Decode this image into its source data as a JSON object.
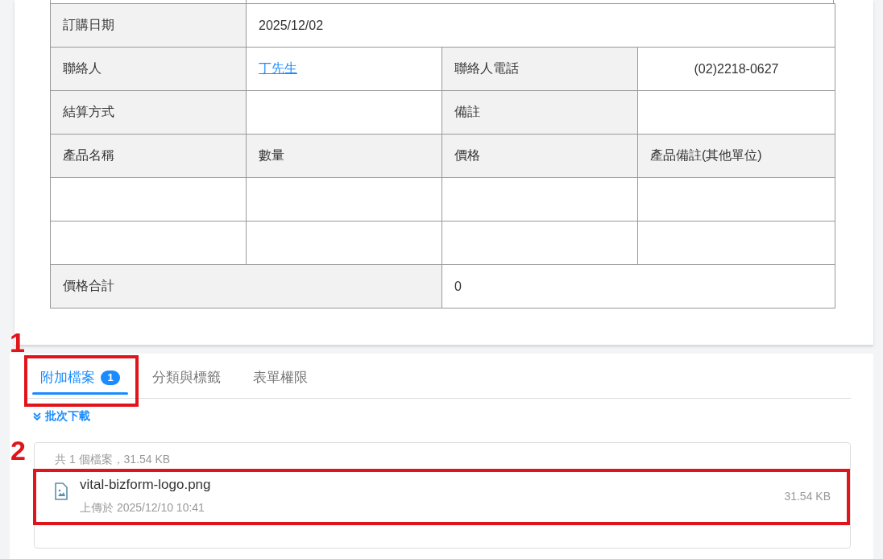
{
  "order_table": {
    "rows": [
      {
        "cells": [
          {
            "kind": "label",
            "text": "訂購日期"
          },
          {
            "kind": "value",
            "text": "2025/12/02",
            "colspan": 3
          }
        ]
      },
      {
        "cells": [
          {
            "kind": "label",
            "text": "聯絡人"
          },
          {
            "kind": "link",
            "text": "丁先生 "
          },
          {
            "kind": "label",
            "text": "聯絡人電話"
          },
          {
            "kind": "centered",
            "text": "(02)2218-0627"
          }
        ]
      },
      {
        "cells": [
          {
            "kind": "label",
            "text": "結算方式"
          },
          {
            "kind": "value"
          },
          {
            "kind": "label",
            "text": "備註"
          },
          {
            "kind": "value"
          }
        ]
      },
      {
        "cells": [
          {
            "kind": "label",
            "text": "產品名稱"
          },
          {
            "kind": "label",
            "text": "數量"
          },
          {
            "kind": "label",
            "text": "價格"
          },
          {
            "kind": "label",
            "text": "產品備註(其他單位)"
          }
        ]
      },
      {
        "cells": [
          {
            "kind": "value"
          },
          {
            "kind": "value"
          },
          {
            "kind": "value"
          },
          {
            "kind": "value"
          }
        ]
      },
      {
        "cells": [
          {
            "kind": "value"
          },
          {
            "kind": "value"
          },
          {
            "kind": "value"
          },
          {
            "kind": "value"
          }
        ]
      },
      {
        "cells": [
          {
            "kind": "label",
            "text": "價格合計",
            "colspan": 2
          },
          {
            "kind": "value",
            "text": "0",
            "colspan": 2
          }
        ]
      }
    ]
  },
  "tabs": [
    {
      "label": "附加檔案",
      "badge": "1",
      "selected": true,
      "annotation": "1"
    },
    {
      "label": "分類與標籤",
      "selected": false
    },
    {
      "label": "表單權限",
      "selected": false
    }
  ],
  "batch_download": "批次下載",
  "file_list": {
    "summary": "共 1 個檔案，31.54 KB",
    "files": [
      {
        "name": "vital-bizform-logo.png",
        "uploaded": "上傳於 2025/12/10 10:41",
        "size": "31.54 KB",
        "annotation": "2"
      }
    ]
  }
}
